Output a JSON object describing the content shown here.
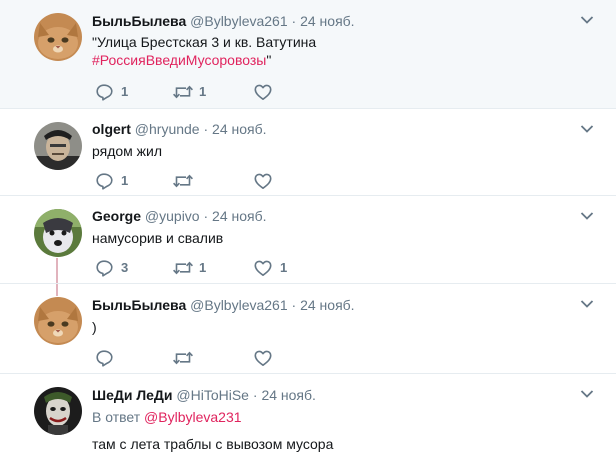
{
  "tweets": [
    {
      "name": "БыльБылева",
      "handle": "@Bylbyleva261",
      "dot": "·",
      "time": "24 нояб.",
      "text_line1": "\"Улица Брестская 3 и кв. Ватутина",
      "text_hashtag": "#РоссияВведиМусоровозы",
      "text_tail": "\"",
      "replies": "1",
      "retweets": "1",
      "likes": ""
    },
    {
      "name": "olgert",
      "handle": "@hryunde",
      "dot": "·",
      "time": "24 нояб.",
      "text": "рядом жил",
      "replies": "1",
      "retweets": "",
      "likes": ""
    },
    {
      "name": "George",
      "handle": "@yupivo",
      "dot": "·",
      "time": "24 нояб.",
      "text": "намусорив и свалив",
      "replies": "3",
      "retweets": "1",
      "likes": "1"
    },
    {
      "name": "БыльБылева",
      "handle": "@Bylbyleva261",
      "dot": "·",
      "time": "24 нояб.",
      "text": ")",
      "replies": "",
      "retweets": "",
      "likes": ""
    },
    {
      "name": "ШеДи ЛеДи",
      "handle": "@HiToHiSe",
      "dot": "·",
      "time": "24 нояб.",
      "reply_prefix": "В ответ",
      "reply_mention": "@Bylbyleva231",
      "text": "там с лета траблы с вывозом мусора"
    }
  ],
  "icons": {
    "reply": "reply-icon",
    "retweet": "retweet-icon",
    "like": "heart-icon",
    "more": "chevron-down-icon"
  },
  "colors": {
    "accent": "#e0245e",
    "thread_line": "#e1b3bd",
    "muted": "#657786",
    "highlight_bg": "#f5f8fa"
  }
}
